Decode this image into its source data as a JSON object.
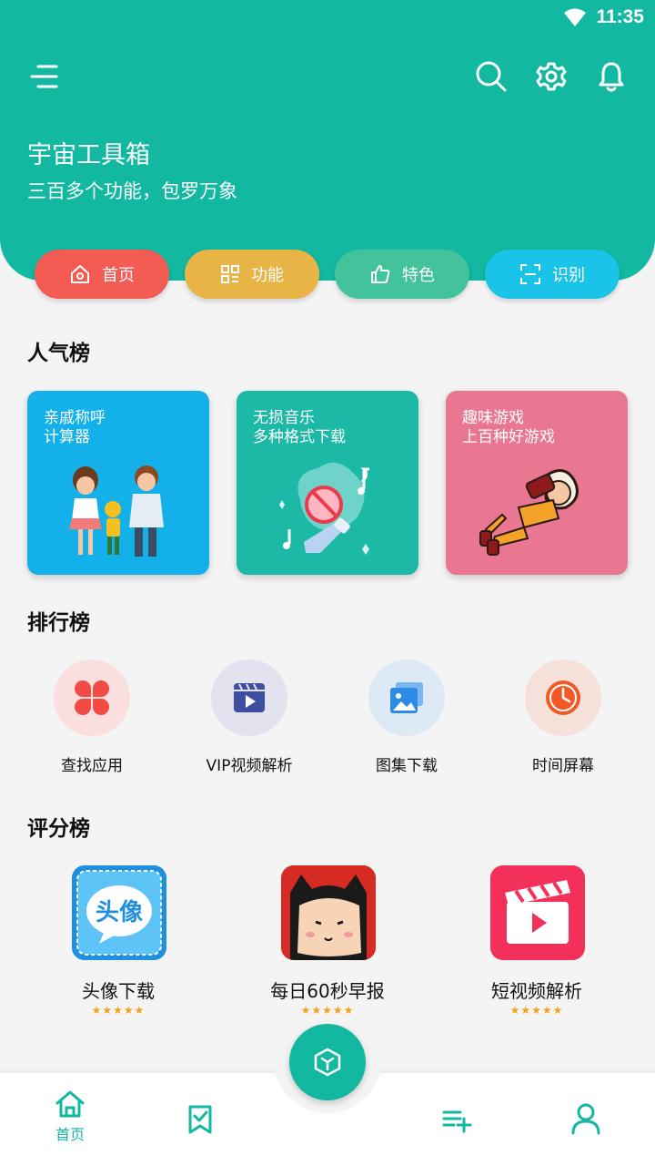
{
  "status_bar": {
    "time": "11:35",
    "icons": [
      "wifi-icon"
    ]
  },
  "header": {
    "title": "宇宙工具箱",
    "subtitle": "三百多个功能，包罗万象",
    "icons": [
      "menu-icon",
      "search-icon",
      "gear-icon",
      "bell-icon"
    ],
    "bg_color": "#13b8a0"
  },
  "quick_tabs": [
    {
      "label": "首页",
      "icon": "home-icon",
      "color": "#f45b52"
    },
    {
      "label": "功能",
      "icon": "grid-icon",
      "color": "#e8b446"
    },
    {
      "label": "特色",
      "icon": "thumbs-up-icon",
      "color": "#43c39b"
    },
    {
      "label": "识别",
      "icon": "scan-icon",
      "color": "#1ac3e8"
    }
  ],
  "popular": {
    "title": "人气榜",
    "cards": [
      {
        "line1": "亲戚称呼",
        "line2": "计算器",
        "color": "#14b0ea",
        "icon": "family-illustration"
      },
      {
        "line1": "无损音乐",
        "line2": "多种格式下载",
        "color": "#1cb9a6",
        "icon": "microphone-illustration"
      },
      {
        "line1": "趣味游戏",
        "line2": "上百种好游戏",
        "color": "#ea7792",
        "icon": "game-player-illustration"
      }
    ]
  },
  "ranking": {
    "title": "排行榜",
    "items": [
      {
        "label": "查找应用",
        "icon": "clover-icon",
        "bg": "#fbdfdf"
      },
      {
        "label": "VIP视频解析",
        "icon": "video-icon",
        "bg": "#e2e3ee"
      },
      {
        "label": "图集下载",
        "icon": "gallery-icon",
        "bg": "#dde9f5"
      },
      {
        "label": "时间屏幕",
        "icon": "clock-icon",
        "bg": "#f6e0da"
      }
    ]
  },
  "rating": {
    "title": "评分榜",
    "items": [
      {
        "name": "头像下载",
        "icon": "avatar-download-icon",
        "rating": "★★★★★"
      },
      {
        "name": "每日60秒早报",
        "icon": "cartoon-face-icon",
        "rating": "★★★★★"
      },
      {
        "name": "短视频解析",
        "icon": "clapperboard-icon",
        "rating": "★★★★★"
      }
    ]
  },
  "bottom_nav": {
    "items": [
      {
        "label": "首页",
        "icon": "home-icon",
        "active": true
      },
      {
        "label": "",
        "icon": "bookmark-check-icon"
      },
      {
        "label": "",
        "icon": "cube-icon"
      },
      {
        "label": "",
        "icon": "playlist-add-icon"
      },
      {
        "label": "",
        "icon": "user-icon"
      }
    ],
    "accent": "#13b8a0"
  }
}
